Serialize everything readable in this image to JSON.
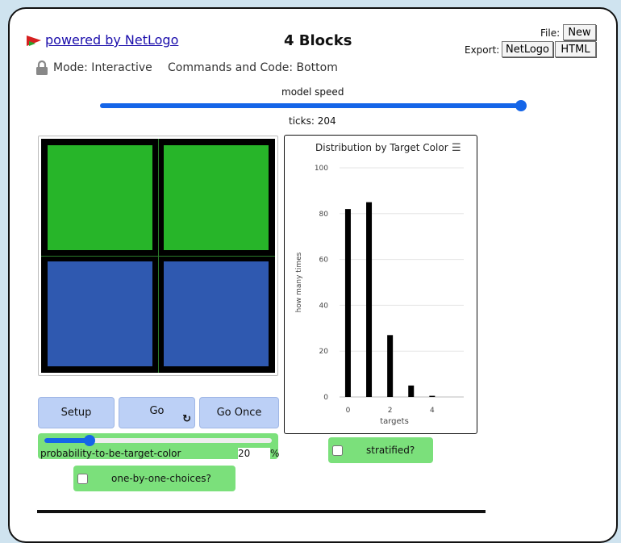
{
  "header": {
    "powered_by": "powered by NetLogo",
    "title": "4 Blocks",
    "file_label": "File:",
    "new_button": "New",
    "export_label": "Export:",
    "export_netlogo": "NetLogo",
    "export_html": "HTML"
  },
  "mode_bar": {
    "mode": "Mode: Interactive",
    "commands": "Commands and Code: Bottom",
    "lock_icon": "lock-icon"
  },
  "speed": {
    "label": "model speed",
    "value": 1.0,
    "color": "#1565e8"
  },
  "ticks_text": "ticks: 204",
  "world_view": {
    "patches": [
      {
        "color": "#27b529"
      },
      {
        "color": "#27b529"
      },
      {
        "color": "#2f59b0"
      },
      {
        "color": "#2f59b0"
      }
    ]
  },
  "plot": {
    "title": "Distribution by Target Color",
    "menu_icon": "hamburger-menu-icon"
  },
  "chart_data": {
    "type": "bar",
    "title": "Distribution by Target Color",
    "xlabel": "targets",
    "ylabel": "how many times",
    "x": [
      0,
      1,
      2,
      3,
      4
    ],
    "values": [
      82,
      85,
      27,
      5,
      0.5
    ],
    "xlim": [
      -0.4,
      5.5
    ],
    "ylim": [
      0,
      100
    ],
    "xticks": [
      "0",
      "2",
      "4"
    ],
    "yticks": [
      "0",
      "20",
      "40",
      "60",
      "80",
      "100"
    ],
    "grid": true,
    "bar_color": "#000000"
  },
  "buttons": {
    "setup": "Setup",
    "go": "Go",
    "go_once": "Go Once",
    "forever_icon": "forever-icon"
  },
  "slider": {
    "name": "probability-to-be-target-color",
    "value": "20",
    "unit": "%",
    "min": 0,
    "max": 100,
    "fraction": 0.2
  },
  "switches": {
    "stratified": "stratified?",
    "one_by_one": "one-by-one-choices?"
  }
}
